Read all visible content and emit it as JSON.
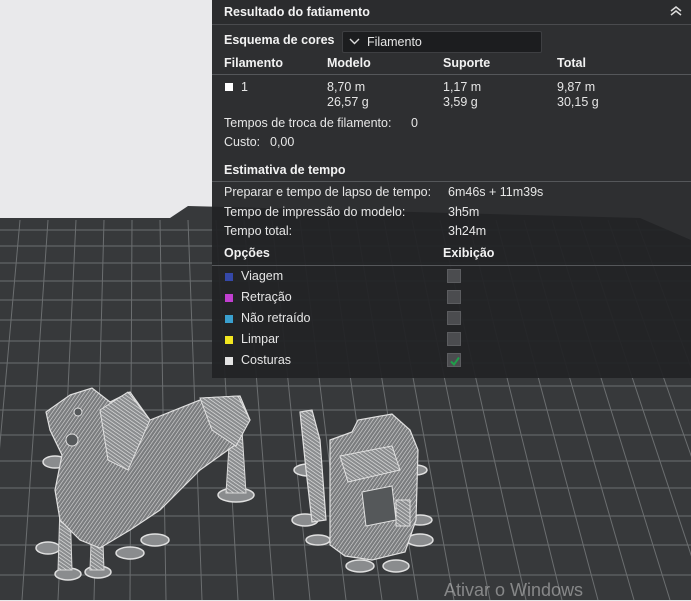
{
  "panel": {
    "title": "Resultado do fatiamento",
    "color_scheme_label": "Esquema de cores",
    "color_scheme_value": "Filamento",
    "headers": {
      "filament": "Filamento",
      "model": "Modelo",
      "support": "Suporte",
      "total": "Total"
    },
    "filament_row": {
      "id": "1",
      "model_length": "8,70 m",
      "model_weight": "26,57 g",
      "support_length": "1,17 m",
      "support_weight": "3,59 g",
      "total_length": "9,87 m",
      "total_weight": "30,15 g"
    },
    "filament_change": {
      "label": "Tempos de troca de filamento:",
      "value": "0"
    },
    "cost": {
      "label": "Custo:",
      "value": "0,00"
    },
    "time_section": {
      "title": "Estimativa de tempo",
      "rows": [
        {
          "label": "Preparar e tempo de lapso de tempo:",
          "value": "6m46s + 11m39s"
        },
        {
          "label": "Tempo de impressão do modelo:",
          "value": "3h5m"
        },
        {
          "label": "Tempo total:",
          "value": "3h24m"
        }
      ]
    },
    "options": {
      "header_options": "Opções",
      "header_display": "Exibição",
      "items": [
        {
          "label": "Viagem",
          "color": "#3548a8",
          "checked": false
        },
        {
          "label": "Retração",
          "color": "#c13fd0",
          "checked": false
        },
        {
          "label": "Não retraído",
          "color": "#3aa0cf",
          "checked": false
        },
        {
          "label": "Limpar",
          "color": "#f2e620",
          "checked": false
        },
        {
          "label": "Costuras",
          "color": "#e4e4e4",
          "checked": true
        }
      ]
    }
  },
  "colors": {
    "accent_check": "#1f9e4a",
    "bed": "#37393b",
    "grid": "#6b6e70"
  },
  "watermark": "Ativar o Windows"
}
